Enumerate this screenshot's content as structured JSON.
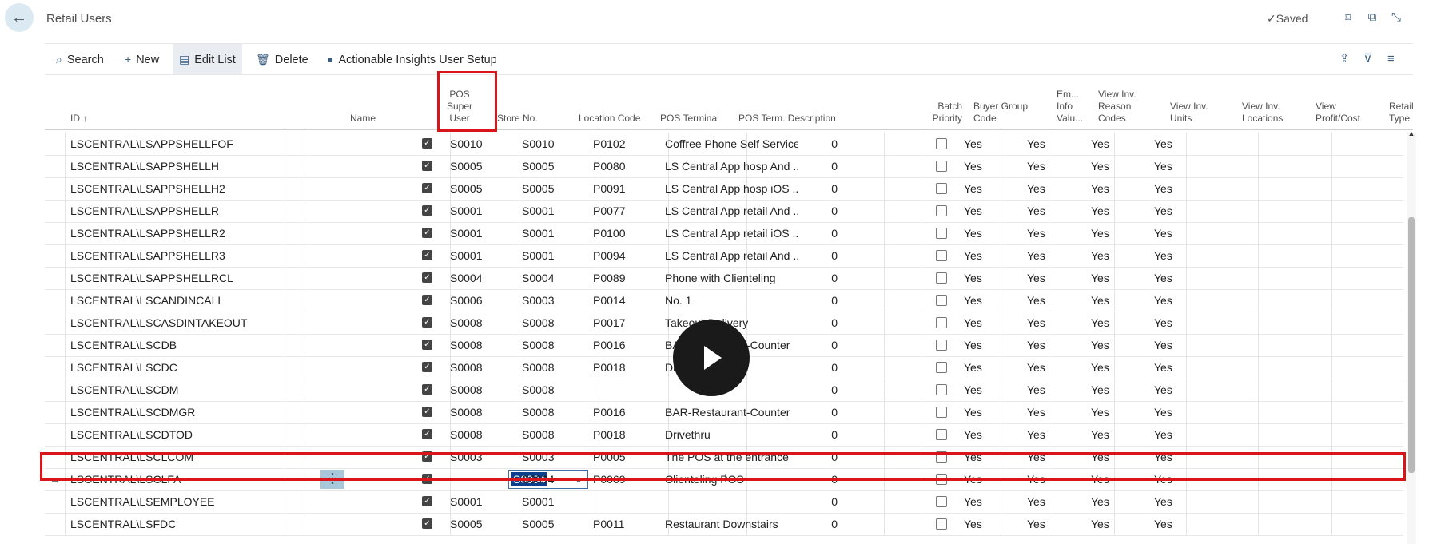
{
  "window": {
    "title": "Retail Users",
    "status": "Saved"
  },
  "icons": {
    "back": "back-arrow-icon",
    "saved": "checkmark-icon",
    "bookmark": "bookmark-icon",
    "open_new": "open-in-new-window-icon",
    "collapse": "collapse-icon",
    "search": "search-icon",
    "new": "plus-icon",
    "edit_list": "edit-list-icon",
    "delete": "trash-icon",
    "user": "user-icon",
    "share": "share-icon",
    "filter": "filter-icon",
    "list": "list-icon",
    "play": "play-icon"
  },
  "toolbar": {
    "search": "Search",
    "new": "New",
    "edit_list": "Edit List",
    "delete": "Delete",
    "insights": "Actionable Insights User Setup"
  },
  "columns": {
    "id": "ID ↑",
    "name": "Name",
    "pos_super_user": [
      "POS",
      "Super",
      "User"
    ],
    "store_no": "Store No.",
    "location_code": "Location Code",
    "pos_terminal": "POS Terminal",
    "pos_term_description": "POS Term. Description",
    "batch_priority": [
      "Batch",
      "Priority"
    ],
    "buyer_group_code": [
      "Buyer Group",
      "Code"
    ],
    "em_info_value": [
      "Em...",
      "Info",
      "Valu..."
    ],
    "view_inv_reason_codes": [
      "View Inv.",
      "Reason",
      "Codes"
    ],
    "view_inv_units": [
      "View Inv.",
      "Units"
    ],
    "view_inv_locations": [
      "View Inv.",
      "Locations"
    ],
    "view_profit_cost": [
      "View",
      "Profit/Cost"
    ],
    "retail_type": [
      "Retail",
      "Type"
    ]
  },
  "rows": [
    {
      "id": "LSCENTRAL\\LSAPPSHELLFOF",
      "super": true,
      "store": "S0010",
      "location": "S0010",
      "terminal": "P0102",
      "description": "Coffree Phone Self Service",
      "batch": "0",
      "em": false,
      "reason": "Yes",
      "units": "Yes",
      "locations": "Yes",
      "profit": "Yes"
    },
    {
      "id": "LSCENTRAL\\LSAPPSHELLH",
      "super": true,
      "store": "S0005",
      "location": "S0005",
      "terminal": "P0080",
      "description": "LS Central App hosp And ...",
      "batch": "0",
      "em": false,
      "reason": "Yes",
      "units": "Yes",
      "locations": "Yes",
      "profit": "Yes"
    },
    {
      "id": "LSCENTRAL\\LSAPPSHELLH2",
      "super": true,
      "store": "S0005",
      "location": "S0005",
      "terminal": "P0091",
      "description": "LS Central App hosp iOS ...",
      "batch": "0",
      "em": false,
      "reason": "Yes",
      "units": "Yes",
      "locations": "Yes",
      "profit": "Yes"
    },
    {
      "id": "LSCENTRAL\\LSAPPSHELLR",
      "super": true,
      "store": "S0001",
      "location": "S0001",
      "terminal": "P0077",
      "description": "LS Central App retail And ...",
      "batch": "0",
      "em": false,
      "reason": "Yes",
      "units": "Yes",
      "locations": "Yes",
      "profit": "Yes"
    },
    {
      "id": "LSCENTRAL\\LSAPPSHELLR2",
      "super": true,
      "store": "S0001",
      "location": "S0001",
      "terminal": "P0100",
      "description": "LS Central App retail iOS ...",
      "batch": "0",
      "em": false,
      "reason": "Yes",
      "units": "Yes",
      "locations": "Yes",
      "profit": "Yes"
    },
    {
      "id": "LSCENTRAL\\LSAPPSHELLR3",
      "super": true,
      "store": "S0001",
      "location": "S0001",
      "terminal": "P0094",
      "description": "LS Central App retail And ...",
      "batch": "0",
      "em": false,
      "reason": "Yes",
      "units": "Yes",
      "locations": "Yes",
      "profit": "Yes"
    },
    {
      "id": "LSCENTRAL\\LSAPPSHELLRCL",
      "super": true,
      "store": "S0004",
      "location": "S0004",
      "terminal": "P0089",
      "description": "Phone  with Clienteling",
      "batch": "0",
      "em": false,
      "reason": "Yes",
      "units": "Yes",
      "locations": "Yes",
      "profit": "Yes"
    },
    {
      "id": "LSCENTRAL\\LSCANDINCALL",
      "super": true,
      "store": "S0006",
      "location": "S0003",
      "terminal": "P0014",
      "description": "No. 1",
      "batch": "0",
      "em": false,
      "reason": "Yes",
      "units": "Yes",
      "locations": "Yes",
      "profit": "Yes"
    },
    {
      "id": "LSCENTRAL\\LSCASDINTAKEOUT",
      "super": true,
      "store": "S0008",
      "location": "S0008",
      "terminal": "P0017",
      "description": "Takeout-Delivery",
      "batch": "0",
      "em": false,
      "reason": "Yes",
      "units": "Yes",
      "locations": "Yes",
      "profit": "Yes"
    },
    {
      "id": "LSCENTRAL\\LSCDB",
      "super": true,
      "store": "S0008",
      "location": "S0008",
      "terminal": "P0016",
      "description": "BAR-Restaurant-Counter",
      "batch": "0",
      "em": false,
      "reason": "Yes",
      "units": "Yes",
      "locations": "Yes",
      "profit": "Yes"
    },
    {
      "id": "LSCENTRAL\\LSCDC",
      "super": true,
      "store": "S0008",
      "location": "S0008",
      "terminal": "P0018",
      "description": "Drivethru",
      "batch": "0",
      "em": false,
      "reason": "Yes",
      "units": "Yes",
      "locations": "Yes",
      "profit": "Yes"
    },
    {
      "id": "LSCENTRAL\\LSCDM",
      "super": true,
      "store": "S0008",
      "location": "S0008",
      "terminal": "",
      "description": "",
      "batch": "0",
      "em": false,
      "reason": "Yes",
      "units": "Yes",
      "locations": "Yes",
      "profit": "Yes"
    },
    {
      "id": "LSCENTRAL\\LSCDMGR",
      "super": true,
      "store": "S0008",
      "location": "S0008",
      "terminal": "P0016",
      "description": "BAR-Restaurant-Counter",
      "batch": "0",
      "em": false,
      "reason": "Yes",
      "units": "Yes",
      "locations": "Yes",
      "profit": "Yes"
    },
    {
      "id": "LSCENTRAL\\LSCDTOD",
      "super": true,
      "store": "S0008",
      "location": "S0008",
      "terminal": "P0018",
      "description": "Drivethru",
      "batch": "0",
      "em": false,
      "reason": "Yes",
      "units": "Yes",
      "locations": "Yes",
      "profit": "Yes"
    },
    {
      "id": "LSCENTRAL\\LSCLCOM",
      "super": true,
      "store": "S0003",
      "location": "S0003",
      "terminal": "P0005",
      "description": "The POS at the entrance",
      "batch": "0",
      "em": false,
      "reason": "Yes",
      "units": "Yes",
      "locations": "Yes",
      "profit": "Yes"
    },
    {
      "id": "LSCENTRAL\\LSCLFA",
      "super": true,
      "store": "S0004",
      "location": "S0004",
      "terminal": "P0069",
      "description": "Clienteling POS",
      "batch": "0",
      "em": false,
      "reason": "Yes",
      "units": "Yes",
      "locations": "Yes",
      "profit": "Yes",
      "selected": true
    },
    {
      "id": "LSCENTRAL\\LSEMPLOYEE",
      "super": true,
      "store": "S0001",
      "location": "S0001",
      "terminal": "",
      "description": "",
      "batch": "0",
      "em": false,
      "reason": "Yes",
      "units": "Yes",
      "locations": "Yes",
      "profit": "Yes"
    },
    {
      "id": "LSCENTRAL\\LSFDC",
      "super": true,
      "store": "S0005",
      "location": "S0005",
      "terminal": "P0011",
      "description": "Restaurant Downstairs",
      "batch": "0",
      "em": false,
      "reason": "Yes",
      "units": "Yes",
      "locations": "Yes",
      "profit": "Yes"
    }
  ],
  "colors": {
    "highlight": "#d9141b",
    "accent": "#3a5d82",
    "selection": "#0b3f8c"
  }
}
